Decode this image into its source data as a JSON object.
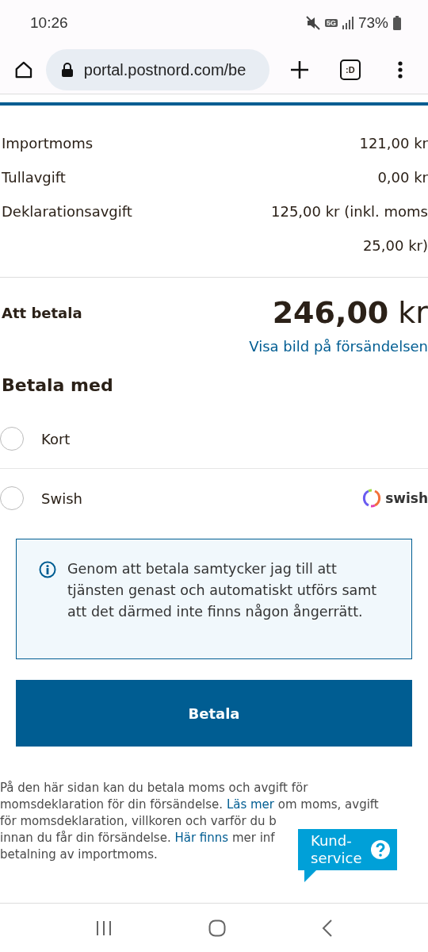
{
  "status_bar": {
    "time": "10:26",
    "network": "5G",
    "battery": "73%"
  },
  "browser": {
    "url": "portal.postnord.com/be",
    "tab_switcher": ":D"
  },
  "fees": [
    {
      "label": "Importmoms",
      "value": [
        "121,00 kr"
      ]
    },
    {
      "label": "Tullavgift",
      "value": [
        "0,00 kr"
      ]
    },
    {
      "label": "Deklarationsavgift",
      "value": [
        "125,00 kr (inkl. moms",
        "25,00 kr)"
      ]
    }
  ],
  "total": {
    "label": "Att betala",
    "amount": "246,00",
    "currency": "kr"
  },
  "image_link": "Visa bild på försändelsen",
  "payment": {
    "heading": "Betala med",
    "options": [
      {
        "label": "Kort",
        "selected": false
      },
      {
        "label": "Swish",
        "selected": false,
        "logo": "swish"
      }
    ]
  },
  "notice": "Genom att betala samtycker jag till att tjänsten genast och automatiskt utförs samt att det därmed inte finns någon ångerrätt.",
  "pay_button": "Betala",
  "footer_lines": [
    [
      {
        "text": "På den här sidan kan du betala moms och avgift för",
        "link": false
      }
    ],
    [
      {
        "text": "momsdeklaration för din försändelse. ",
        "link": false
      },
      {
        "text": "Läs mer",
        "link": true
      },
      {
        "text": " om moms, avgift",
        "link": false
      }
    ],
    [
      {
        "text": "för momsdeklaration, villkoren och varför du b",
        "link": false
      }
    ],
    [
      {
        "text": "innan du får din försändelse. ",
        "link": false
      },
      {
        "text": "Här finns",
        "link": true
      },
      {
        "text": " mer inf",
        "link": false
      }
    ],
    [
      {
        "text": "betalning av importmoms.",
        "link": false
      }
    ]
  ],
  "support_bubble": {
    "label": [
      "Kund-",
      "service"
    ]
  }
}
